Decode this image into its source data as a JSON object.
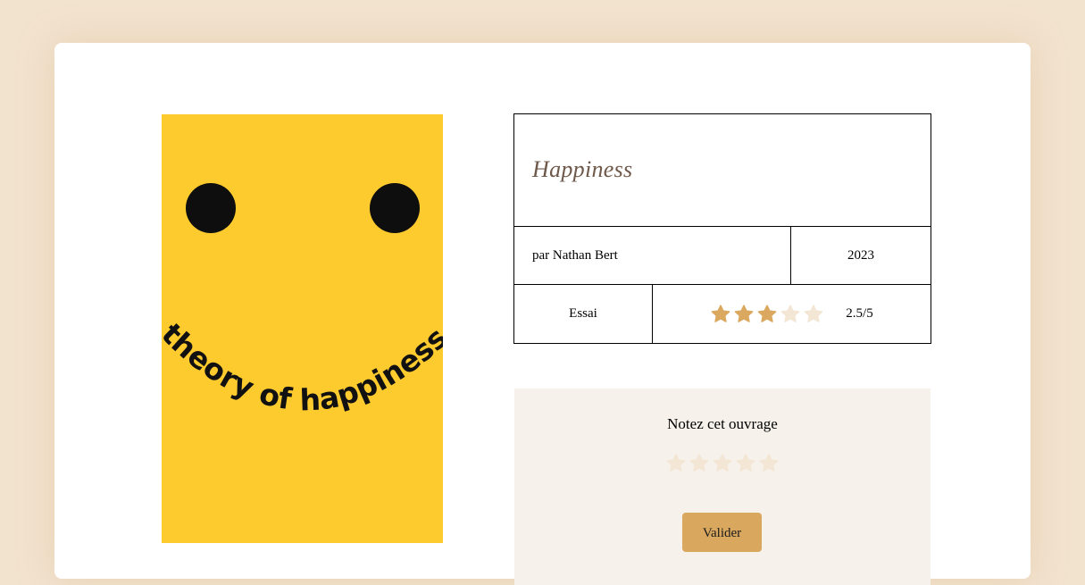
{
  "book": {
    "title": "Happiness",
    "author_line": "par Nathan Bert",
    "year": "2023",
    "genre": "Essai",
    "rating_text": "2.5/5",
    "average_rating": 2.5,
    "max_rating": 5,
    "cover_text": "theory of happiness"
  },
  "rate": {
    "title": "Notez cet ouvrage",
    "submit_label": "Valider",
    "current_rating": 0
  },
  "colors": {
    "background": "#f2e3cf",
    "star_filled": "#dba860",
    "star_empty": "#f3e6d4",
    "button": "#d9a85e",
    "cover": "#fecb2f",
    "title": "#6e5849"
  }
}
